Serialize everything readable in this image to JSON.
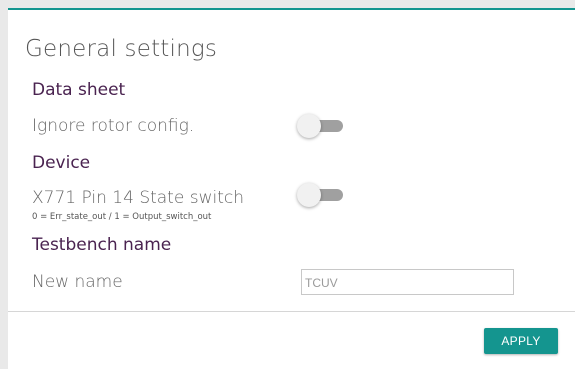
{
  "panel": {
    "title": "General settings"
  },
  "sections": {
    "data_sheet": {
      "title": "Data sheet",
      "ignore_rotor": {
        "label": "Ignore rotor config.",
        "enabled": false
      }
    },
    "device": {
      "title": "Device",
      "state_switch": {
        "label": "X771 Pin 14 State switch",
        "sublabel": "0 = Err_state_out / 1 = Output_switch_out",
        "enabled": false
      }
    },
    "testbench": {
      "title": "Testbench name",
      "new_name": {
        "label": "New name",
        "value": "TCUV"
      }
    }
  },
  "actions": {
    "apply_label": "APPLY"
  },
  "colors": {
    "accent": "#14958f",
    "section_title": "#4a2350",
    "toggle_off_track": "#a0a0a0"
  }
}
